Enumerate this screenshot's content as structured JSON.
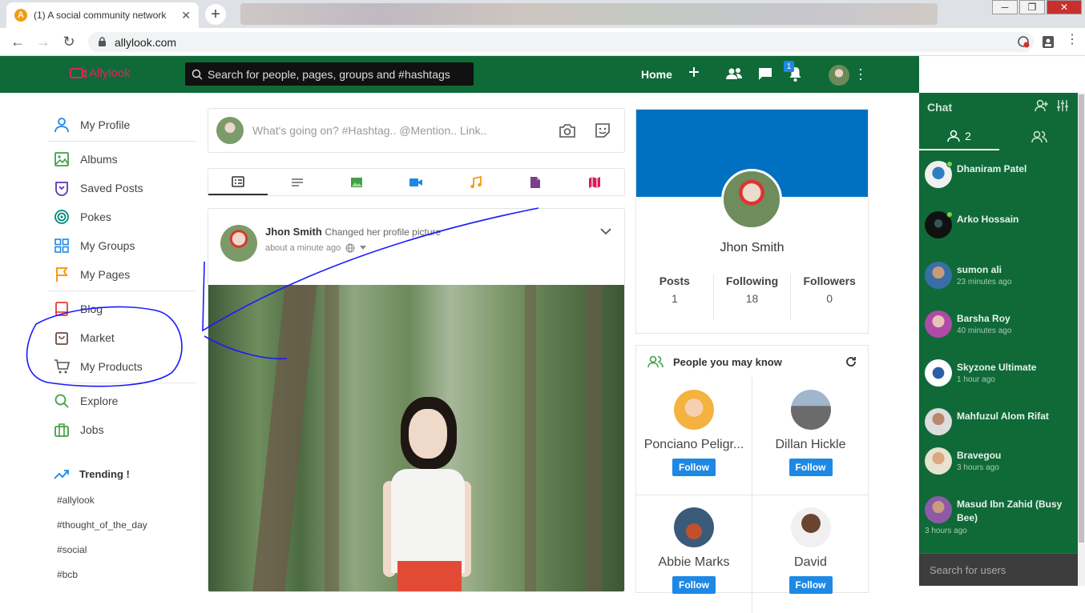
{
  "browser": {
    "tab_title": "(1) A social community network",
    "tab_close": "✕",
    "new_tab": "+",
    "url": "allylook.com"
  },
  "header": {
    "logo_text": "Allylook",
    "search_placeholder": "Search for people, pages, groups and #hashtags",
    "home_label": "Home",
    "notification_count": "1"
  },
  "sidebar": {
    "items": [
      {
        "label": "My Profile",
        "icon": "user-icon",
        "color": "#1e88e5"
      },
      {
        "label": "Albums",
        "icon": "image-icon",
        "color": "#43a047"
      },
      {
        "label": "Saved Posts",
        "icon": "bookmark-icon",
        "color": "#5e35b1"
      },
      {
        "label": "Pokes",
        "icon": "target-icon",
        "color": "#00897b"
      },
      {
        "label": "My Groups",
        "icon": "grid-icon",
        "color": "#1e88e5"
      },
      {
        "label": "My Pages",
        "icon": "flag-icon",
        "color": "#fb8c00"
      },
      {
        "label": "Blog",
        "icon": "book-icon",
        "color": "#e53935"
      },
      {
        "label": "Market",
        "icon": "bag-icon",
        "color": "#6d4c41"
      },
      {
        "label": "My Products",
        "icon": "cart-icon",
        "color": "#555555"
      },
      {
        "label": "Explore",
        "icon": "search-icon",
        "color": "#43a047"
      },
      {
        "label": "Jobs",
        "icon": "briefcase-icon",
        "color": "#43a047"
      }
    ],
    "trending_title": "Trending !",
    "hashtags": [
      "#allylook",
      "#thought_of_the_day",
      "#social",
      "#bcb"
    ]
  },
  "composer": {
    "placeholder": "What's going on? #Hashtag.. @Mention.. Link.."
  },
  "post": {
    "author": "Jhon Smith",
    "action": "Changed her profile picture",
    "time": "about a minute ago"
  },
  "profile": {
    "name": "Jhon Smith",
    "stats": [
      {
        "label": "Posts",
        "value": "1"
      },
      {
        "label": "Following",
        "value": "18"
      },
      {
        "label": "Followers",
        "value": "0"
      }
    ]
  },
  "people": {
    "title": "People you may know",
    "follow_label": "Follow",
    "list": [
      {
        "name": "Ponciano Peligr..."
      },
      {
        "name": "Dillan Hickle"
      },
      {
        "name": "Abbie Marks"
      },
      {
        "name": "David"
      }
    ]
  },
  "chat": {
    "title": "Chat",
    "online_count": "2",
    "users": [
      {
        "name": "Dhaniram Patel",
        "time": ""
      },
      {
        "name": "Arko Hossain",
        "time": ""
      },
      {
        "name": "sumon ali",
        "time": "23 minutes ago"
      },
      {
        "name": "Barsha Roy",
        "time": "40 minutes ago"
      },
      {
        "name": "Skyzone Ultimate",
        "time": "1 hour ago"
      },
      {
        "name": "Mahfuzul Alom Rifat",
        "time": ""
      },
      {
        "name": "Bravegou",
        "time": "3 hours ago"
      },
      {
        "name": "Masud Ibn Zahid (Busy Bee)",
        "time": "3 hours ago"
      }
    ],
    "search_placeholder": "Search for users"
  }
}
